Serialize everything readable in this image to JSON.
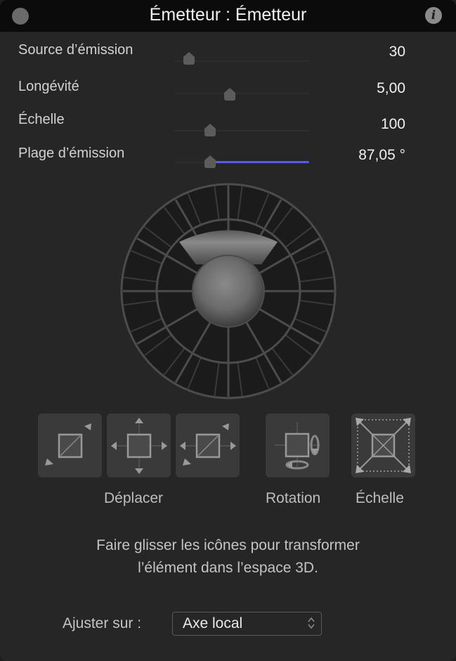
{
  "window": {
    "title": "Émetteur : Émetteur",
    "close_icon": "close-circle",
    "info_icon": "info-i"
  },
  "parameters": [
    {
      "label": "Source d’émission",
      "value": "30",
      "slider_fraction": 0.11
    },
    {
      "label": "Longévité",
      "value": "5,00",
      "slider_fraction": 0.41
    },
    {
      "label": "Échelle",
      "value": "100",
      "slider_fraction": 0.26
    },
    {
      "label": "Plage d’émission",
      "value": "87,05 °",
      "slider_fraction": 0.26,
      "range_fraction_end": 1.0,
      "range_color": "#5a5ae6"
    }
  ],
  "widget": {
    "name": "emission-range-sphere",
    "icon": "sphere-with-cone"
  },
  "tools": {
    "move_label": "Déplacer",
    "rotation_label": "Rotation",
    "scale_label": "Échelle",
    "items": [
      {
        "name": "move-z",
        "icon": "move-diagonal"
      },
      {
        "name": "move-xy",
        "icon": "move-four-arrows"
      },
      {
        "name": "move-xz",
        "icon": "move-horizontal-diagonal"
      },
      {
        "name": "rotate",
        "icon": "rotate-3d"
      },
      {
        "name": "scale",
        "icon": "scale-corners"
      }
    ]
  },
  "help_text": {
    "line1": "Faire glisser les icônes pour transformer",
    "line2": "l’élément dans l’espace 3D."
  },
  "adjust": {
    "label": "Ajuster sur :",
    "selected": "Axe local"
  }
}
